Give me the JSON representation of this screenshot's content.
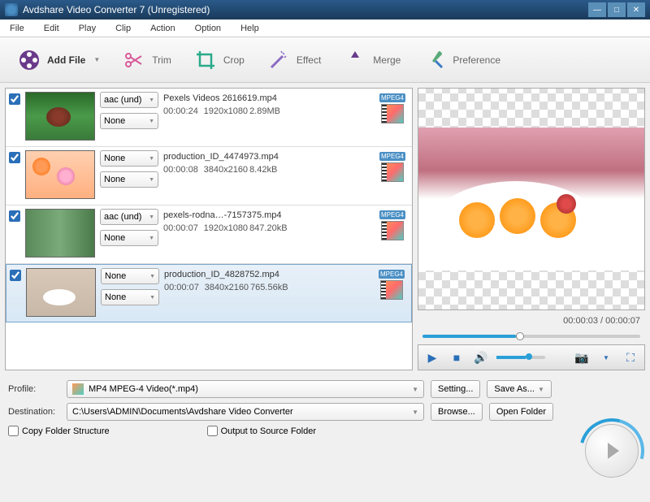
{
  "window": {
    "title": "Avdshare Video Converter 7 (Unregistered)"
  },
  "menu": [
    "File",
    "Edit",
    "Play",
    "Clip",
    "Action",
    "Option",
    "Help"
  ],
  "toolbar": [
    {
      "label": "Add File",
      "icon": "film-roll",
      "active": true,
      "dropdown": true
    },
    {
      "label": "Trim",
      "icon": "scissors"
    },
    {
      "label": "Crop",
      "icon": "crop"
    },
    {
      "label": "Effect",
      "icon": "wand"
    },
    {
      "label": "Merge",
      "icon": "merge"
    },
    {
      "label": "Preference",
      "icon": "tools"
    }
  ],
  "files": [
    {
      "checked": true,
      "audio": "aac (und)",
      "sub": "None",
      "name": "Pexels Videos 2616619.mp4",
      "duration": "00:00:24",
      "res": "1920x1080",
      "size": "2.89MB",
      "format": "MPEG4"
    },
    {
      "checked": true,
      "audio": "None",
      "sub": "None",
      "name": "production_ID_4474973.mp4",
      "duration": "00:00:08",
      "res": "3840x2160",
      "size": "8.42kB",
      "format": "MPEG4"
    },
    {
      "checked": true,
      "audio": "aac (und)",
      "sub": "None",
      "name": "pexels-rodna…-7157375.mp4",
      "duration": "00:00:07",
      "res": "1920x1080",
      "size": "847.20kB",
      "format": "MPEG4"
    },
    {
      "checked": true,
      "audio": "None",
      "sub": "None",
      "name": "production_ID_4828752.mp4",
      "duration": "00:00:07",
      "res": "3840x2160",
      "size": "765.56kB",
      "format": "MPEG4",
      "selected": true
    }
  ],
  "preview": {
    "current": "00:00:03",
    "total": "00:00:07",
    "progress_pct": 43
  },
  "profile": {
    "label": "Profile:",
    "value": "MP4 MPEG-4 Video(*.mp4)",
    "setting_btn": "Setting...",
    "saveas_btn": "Save As..."
  },
  "destination": {
    "label": "Destination:",
    "value": "C:\\Users\\ADMIN\\Documents\\Avdshare Video Converter",
    "browse_btn": "Browse...",
    "open_btn": "Open Folder"
  },
  "options": {
    "copy_folder": "Copy Folder Structure",
    "output_source": "Output to Source Folder"
  }
}
